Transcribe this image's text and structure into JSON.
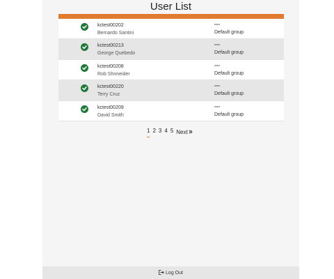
{
  "page": {
    "title": "User List"
  },
  "users": [
    {
      "id": "kctest00202",
      "name": "Bernardo Santini",
      "extra": "---",
      "group": "Default group"
    },
    {
      "id": "kctest00213",
      "name": "George Quebedo",
      "extra": "---",
      "group": "Default group"
    },
    {
      "id": "kctest00208",
      "name": "Rob Shnneider",
      "extra": "---",
      "group": "Default group"
    },
    {
      "id": "kctest00220",
      "name": "Terry Cruz",
      "extra": "---",
      "group": "Default group"
    },
    {
      "id": "kctest00209",
      "name": "David Smith",
      "extra": "---",
      "group": "Default group"
    }
  ],
  "pagination": {
    "pages": [
      "1",
      "2",
      "3",
      "4",
      "5"
    ],
    "current": "1",
    "next_label": "Next"
  },
  "footer": {
    "logout_label": "Log Out"
  },
  "colors": {
    "accent": "#e07b2f",
    "check": "#1f7a3a",
    "panel": "#f5f5f5",
    "row_alt": "#e6e6e6"
  },
  "icons": {
    "status": "check-circle-icon",
    "next": "double-chevron-right-icon",
    "logout": "sign-out-icon"
  }
}
